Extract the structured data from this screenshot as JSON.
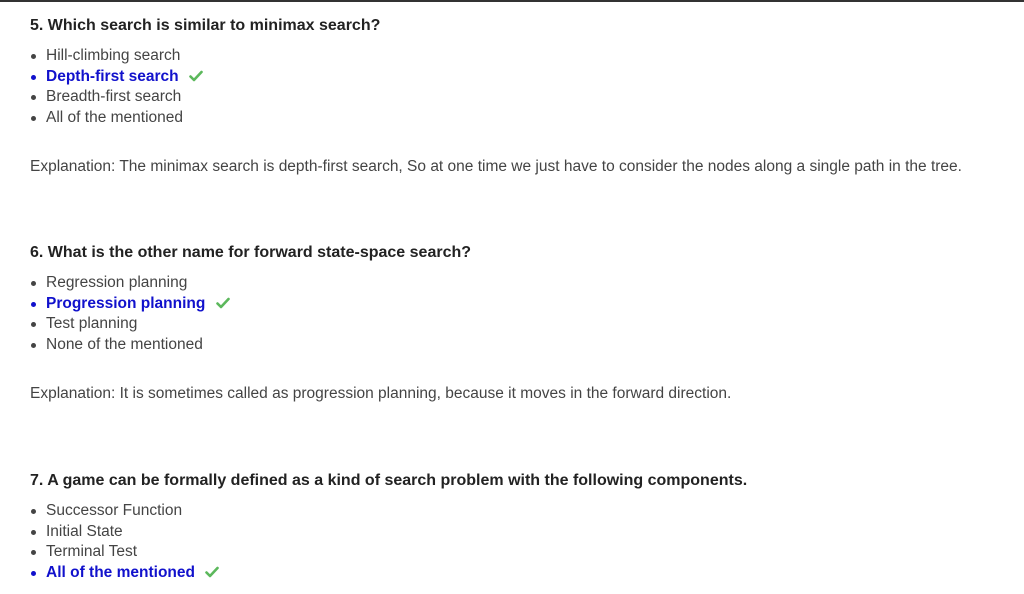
{
  "questions": [
    {
      "title": "5. Which search is similar to minimax search?",
      "options": [
        {
          "text": "Hill-climbing search",
          "correct": false
        },
        {
          "text": "Depth-first search",
          "correct": true
        },
        {
          "text": "Breadth-first search",
          "correct": false
        },
        {
          "text": "All of the mentioned",
          "correct": false
        }
      ],
      "explanation": "Explanation: The minimax search is depth-first search, So at one time we just have to consider the nodes along a single path in the tree."
    },
    {
      "title": "6. What is the other name for forward state-space search?",
      "options": [
        {
          "text": "Regression planning",
          "correct": false
        },
        {
          "text": "Progression planning",
          "correct": true
        },
        {
          "text": "Test planning",
          "correct": false
        },
        {
          "text": "None of the mentioned",
          "correct": false
        }
      ],
      "explanation": "Explanation: It is sometimes called as progression planning, because it moves in the forward direction."
    },
    {
      "title": "7. A game can be formally defined as a kind of search problem with the following components.",
      "options": [
        {
          "text": "Successor Function",
          "correct": false
        },
        {
          "text": "Initial State",
          "correct": false
        },
        {
          "text": "Terminal Test",
          "correct": false
        },
        {
          "text": "All of the mentioned",
          "correct": true
        }
      ]
    }
  ],
  "colors": {
    "correct": "#1111cc",
    "check": "#5cb85c",
    "text": "#444444"
  },
  "icons": {
    "correct_marker": "check-icon"
  }
}
